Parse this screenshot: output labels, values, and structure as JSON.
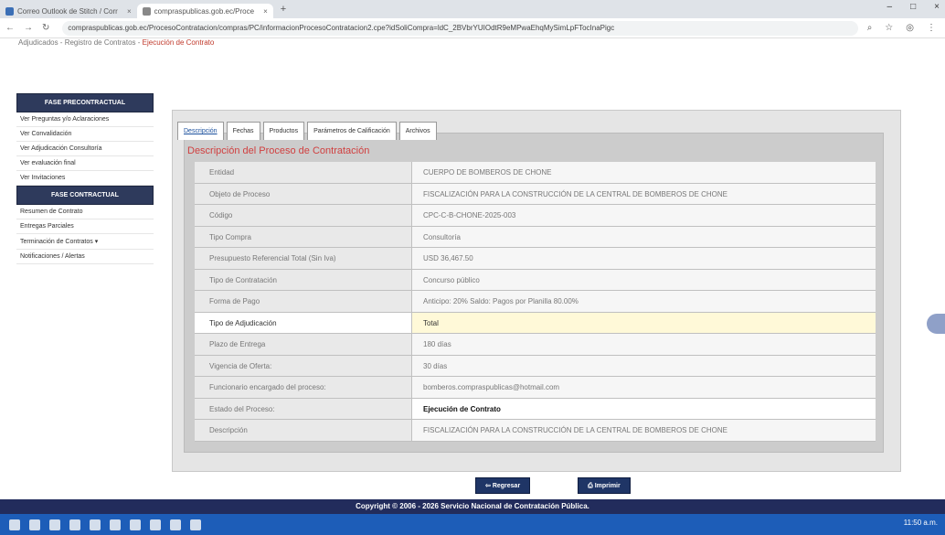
{
  "browser": {
    "tabs": [
      {
        "label": "Correo Outlook de Stitch / Correo - Bus"
      },
      {
        "label": "compraspublicas.gob.ec/Proce"
      }
    ],
    "url": "compraspublicas.gob.ec/ProcesoContratacion/compras/PC/informacionProcesoContratacion2.cpe?idSoliCompra=ldC_2BVbrYUIOdtR9eMPwaEhqMySimLpFTocInaPigc"
  },
  "breadcrumb": {
    "prefix": "Adjudicados - Registro de Contratos",
    "current": "Ejecución de Contrato"
  },
  "sidebar": {
    "section1": "FASE PRECONTRACTUAL",
    "items1": [
      "Ver Preguntas y/o Aclaraciones",
      "Ver Convalidación",
      "Ver Adjudicación Consultoría",
      "Ver evaluación final",
      "Ver Invitaciones"
    ],
    "section2": "FASE CONTRACTUAL",
    "items2": [
      "Resumen de Contrato",
      "Entregas Parciales",
      "Terminación de Contratos",
      "Notificaciones / Alertas"
    ]
  },
  "tabs": [
    "Descripción",
    "Fechas",
    "Productos",
    "Parámetros de Calificación",
    "Archivos"
  ],
  "panel_title": "Descripción del Proceso de Contratación",
  "rows": [
    {
      "label": "Entidad",
      "value": "CUERPO DE BOMBEROS DE CHONE"
    },
    {
      "label": "Objeto de Proceso",
      "value": "FISCALIZACIÓN PARA LA CONSTRUCCIÓN DE LA CENTRAL DE BOMBEROS DE CHONE"
    },
    {
      "label": "Código",
      "value": "CPC-C-B-CHONE-2025-003"
    },
    {
      "label": "Tipo Compra",
      "value": "Consultoría"
    },
    {
      "label": "Presupuesto Referencial Total (Sin Iva)",
      "value": "USD 36,467.50"
    },
    {
      "label": "Tipo de Contratación",
      "value": "Concurso público"
    },
    {
      "label": "Forma de Pago",
      "value": "Anticipo: 20% Saldo: Pagos por Planilla 80.00%"
    },
    {
      "label": "Tipo de Adjudicación",
      "value": "Total"
    },
    {
      "label": "Plazo de Entrega",
      "value": "180 días"
    },
    {
      "label": "Vigencia de Oferta:",
      "value": "30 días"
    },
    {
      "label": "Funcionario encargado del proceso:",
      "value": "bomberos.compraspublicas@hotmail.com"
    },
    {
      "label": "Estado del Proceso:",
      "value": "Ejecución de Contrato"
    },
    {
      "label": "Descripción",
      "value": "FISCALIZACIÓN PARA LA CONSTRUCCIÓN DE LA CENTRAL DE BOMBEROS DE CHONE"
    }
  ],
  "buttons": {
    "back": "Regresar",
    "print": "Imprimir"
  },
  "footer": "Copyright © 2006 - 2026 Servicio Nacional de Contratación Pública.",
  "tray": "11:50 a.m."
}
